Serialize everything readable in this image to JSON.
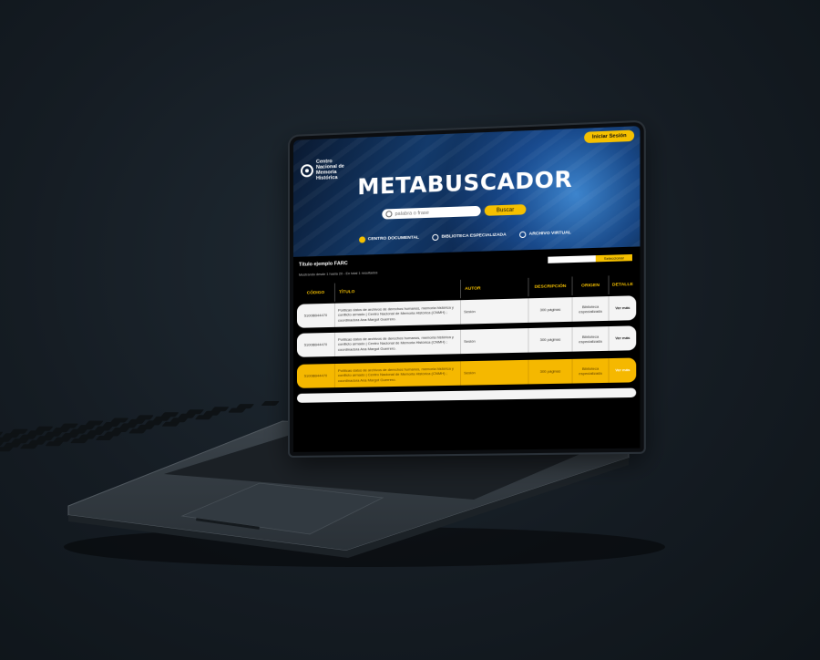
{
  "header": {
    "logo_text": "Centro Nacional de Memoria Histórica",
    "login_label": "Iniciar Sesión",
    "title": "METABUSCADOR"
  },
  "search": {
    "placeholder": "palabra o frase",
    "button_label": "Buscar"
  },
  "filters": [
    {
      "label": "CENTRO DOCUMENTAL",
      "selected": true
    },
    {
      "label": "BIBLIOTECA ESPECIALIZADA",
      "selected": false
    },
    {
      "label": "ARCHIVO VIRTUAL",
      "selected": false
    }
  ],
  "results": {
    "title": "Título ejemplo FARC",
    "meta": "Mostrando desde 1 hasta 20 - En total 1 resultados",
    "select_label": "Seleccionar"
  },
  "table": {
    "headers": [
      "CÓDIGO",
      "TÍTULO",
      "AUTOR",
      "DESCRIPCIÓN",
      "ORIGEN",
      "DETALLE"
    ],
    "rows": [
      {
        "code": "5100BB44470",
        "title": "Políticas datos de archivos de derechos humanos, memoria histórica y conflicto armado | Centro Nacional de Memoria Histórica (CNMH) ; coordinadora Ana Margot Guerrero.",
        "autor": "Sesión",
        "desc": "300 páginas",
        "origen": "Biblioteca especializada",
        "detail": "Ver más",
        "highlight": false
      },
      {
        "code": "5100BB44470",
        "title": "Políticas datos de archivos de derechos humanos, memoria histórica y conflicto armado | Centro Nacional de Memoria Histórica (CNMH) ; coordinadora Ana Margot Guerrero.",
        "autor": "Sesión",
        "desc": "300 páginas",
        "origen": "Biblioteca especializada",
        "detail": "Ver más",
        "highlight": false
      },
      {
        "code": "5100BB44470",
        "title": "Políticas datos de archivos de derechos humanos, memoria histórica y conflicto armado | Centro Nacional de Memoria Histórica (CNMH) ; coordinadora Ana Margot Guerrero.",
        "autor": "Sesión",
        "desc": "300 páginas",
        "origen": "Biblioteca especializada",
        "detail": "Ver más",
        "highlight": true
      }
    ]
  },
  "colors": {
    "accent": "#f5c000",
    "background": "#151c23"
  }
}
